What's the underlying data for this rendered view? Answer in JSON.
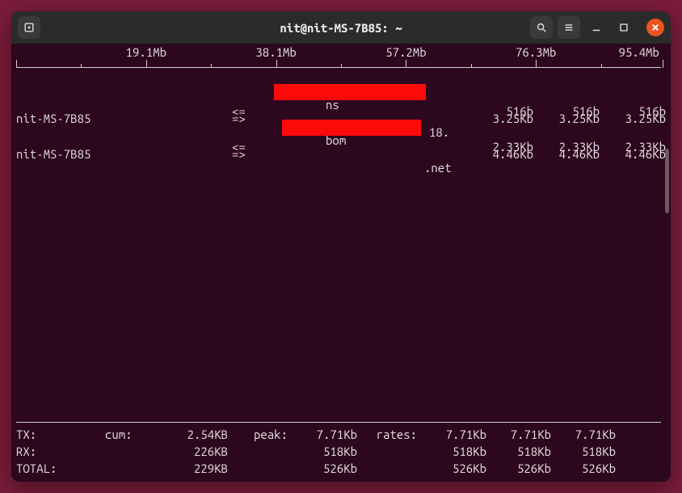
{
  "window": {
    "title": "nit@nit-MS-7B85: ~"
  },
  "scale": {
    "labels": [
      "19.1Mb",
      "38.1Mb",
      "57.2Mb",
      "76.3Mb",
      "95.4Mb"
    ]
  },
  "connections": [
    {
      "src": "nit-MS-7B85",
      "dir_out": "=>",
      "dir_in": "<=",
      "dst_prefix": "ns",
      "dst_suffix": "18.",
      "rates_out": [
        "3.25Kb",
        "3.25Kb",
        "3.25Kb"
      ],
      "rates_in": [
        "516b",
        "516b",
        "516b"
      ]
    },
    {
      "src": "nit-MS-7B85",
      "dir_out": "=>",
      "dir_in": "<=",
      "dst_prefix": "bom",
      "dst_suffix": ".net",
      "rates_out": [
        "4.46Kb",
        "4.46Kb",
        "4.46Kb"
      ],
      "rates_in": [
        "2.33Kb",
        "2.33Kb",
        "2.33Kb"
      ]
    }
  ],
  "footer": {
    "labels": {
      "tx": "TX:",
      "rx": "RX:",
      "total": "TOTAL:",
      "cum": "cum:",
      "peak": "peak:",
      "rates": "rates:"
    },
    "tx": {
      "cum": "2.54KB",
      "peak": "7.71Kb",
      "rates": [
        "7.71Kb",
        "7.71Kb",
        "7.71Kb"
      ]
    },
    "rx": {
      "cum": "226KB",
      "peak": "518Kb",
      "rates": [
        "518Kb",
        "518Kb",
        "518Kb"
      ]
    },
    "total": {
      "cum": "229KB",
      "peak": "526Kb",
      "rates": [
        "526Kb",
        "526Kb",
        "526Kb"
      ]
    }
  }
}
